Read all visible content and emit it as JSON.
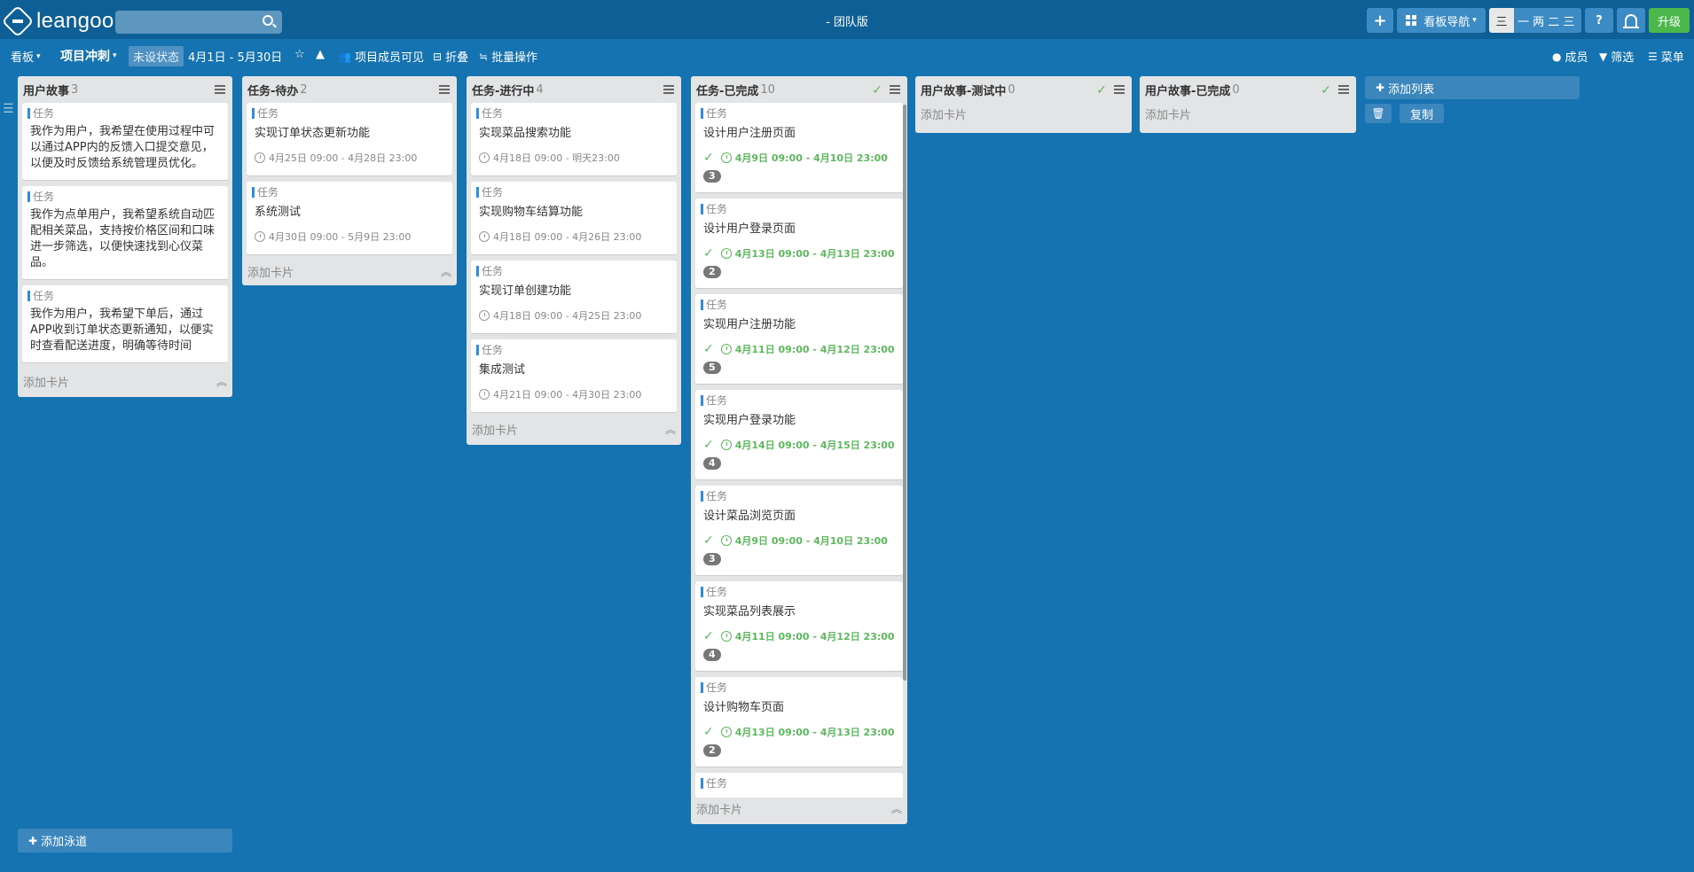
{
  "app": {
    "logo_text": "leangoo",
    "edition": "- 团队版",
    "search_placeholder": ""
  },
  "topbar": {
    "add_label": "+",
    "nav_label": "看板导航",
    "view_seg1": "三",
    "view_seg2": "一 两 二 三",
    "help_label": "?",
    "upgrade_label": "升级"
  },
  "subbar": {
    "board_label": "看板",
    "sprint_label": "项目冲刺",
    "status_label": "未设状态",
    "date_range": "4月1日 - 5月30日",
    "members_visible": "项目成员可见",
    "fold_label": "折叠",
    "batch_label": "批量操作",
    "member_label": "成员",
    "filter_label": "筛选",
    "menu_label": "菜单"
  },
  "lists": [
    {
      "title": "用户故事",
      "count": "3",
      "add_card": "添加卡片",
      "cards": [
        {
          "tag": "任务",
          "title": "我作为用户，我希望在使用过程中可以通过APP内的反馈入口提交意见，以便及时反馈给系统管理员优化。"
        },
        {
          "tag": "任务",
          "title": "我作为点单用户，我希望系统自动匹配相关菜品，支持按价格区间和口味进一步筛选，以便快速找到心仪菜品。"
        },
        {
          "tag": "任务",
          "title": "我作为用户，我希望下单后，通过APP收到订单状态更新通知，以便实时查看配送进度，明确等待时间"
        }
      ]
    },
    {
      "title": "任务-待办",
      "count": "2",
      "add_card": "添加卡片",
      "cards": [
        {
          "tag": "任务",
          "title": "实现订单状态更新功能",
          "time": "4月25日 09:00 - 4月28日 23:00"
        },
        {
          "tag": "任务",
          "title": "系统测试",
          "time": "4月30日 09:00 - 5月9日 23:00"
        }
      ]
    },
    {
      "title": "任务-进行中",
      "count": "4",
      "add_card": "添加卡片",
      "cards": [
        {
          "tag": "任务",
          "title": "实现菜品搜索功能",
          "time": "4月18日 09:00 - 明天23:00"
        },
        {
          "tag": "任务",
          "title": "实现购物车结算功能",
          "time": "4月18日 09:00 - 4月26日 23:00"
        },
        {
          "tag": "任务",
          "title": "实现订单创建功能",
          "time": "4月18日 09:00 - 4月25日 23:00"
        },
        {
          "tag": "任务",
          "title": "集成测试",
          "time": "4月21日 09:00 - 4月30日 23:00"
        }
      ]
    },
    {
      "title": "任务-已完成",
      "count": "10",
      "add_card": "添加卡片",
      "cards": [
        {
          "tag": "任务",
          "title": "设计用户注册页面",
          "time": "4月9日 09:00 - 4月10日 23:00",
          "badge": "3"
        },
        {
          "tag": "任务",
          "title": "设计用户登录页面",
          "time": "4月13日 09:00 - 4月13日 23:00",
          "badge": "2"
        },
        {
          "tag": "任务",
          "title": "实现用户注册功能",
          "time": "4月11日 09:00 - 4月12日 23:00",
          "badge": "5"
        },
        {
          "tag": "任务",
          "title": "实现用户登录功能",
          "time": "4月14日 09:00 - 4月15日 23:00",
          "badge": "4"
        },
        {
          "tag": "任务",
          "title": "设计菜品浏览页面",
          "time": "4月9日 09:00 - 4月10日 23:00",
          "badge": "3"
        },
        {
          "tag": "任务",
          "title": "实现菜品列表展示",
          "time": "4月11日 09:00 - 4月12日 23:00",
          "badge": "4"
        },
        {
          "tag": "任务",
          "title": "设计购物车页面",
          "time": "4月13日 09:00 - 4月13日 23:00",
          "badge": "2"
        },
        {
          "tag": "任务"
        }
      ]
    },
    {
      "title": "用户故事-测试中",
      "count": "0",
      "add_card": "添加卡片",
      "cards": []
    },
    {
      "title": "用户故事-已完成",
      "count": "0",
      "add_card": "添加卡片",
      "cards": []
    }
  ],
  "add_list_label": "添加列表",
  "copy_label": "复制",
  "add_lane_label": "添加泳道",
  "colors": {
    "background": "#1473b0",
    "topbar": "#0d5f95",
    "done_green": "#5cb85c",
    "upgrade_green": "#4cb84c",
    "tag_blue": "#2f8ce0"
  }
}
